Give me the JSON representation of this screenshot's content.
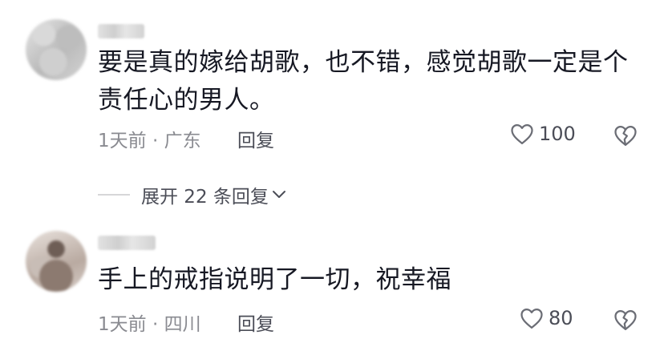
{
  "comments": [
    {
      "text": "要是真的嫁给胡歌，也不错，感觉胡歌一定是个责任心的男人。",
      "time": "1天前",
      "separator": "·",
      "location": "广东",
      "reply_label": "回复",
      "likes": "100",
      "expand_label": "展开 22 条回复"
    },
    {
      "text": "手上的戒指说明了一切，祝幸福",
      "time": "1天前",
      "separator": "·",
      "location": "四川",
      "reply_label": "回复",
      "likes": "80"
    }
  ],
  "icons": {
    "like": "heart-outline-icon",
    "dislike": "broken-heart-icon",
    "expand": "chevron-down-icon"
  },
  "colors": {
    "text": "#161823",
    "meta": "#8a8b91",
    "action": "#4b4d57"
  }
}
